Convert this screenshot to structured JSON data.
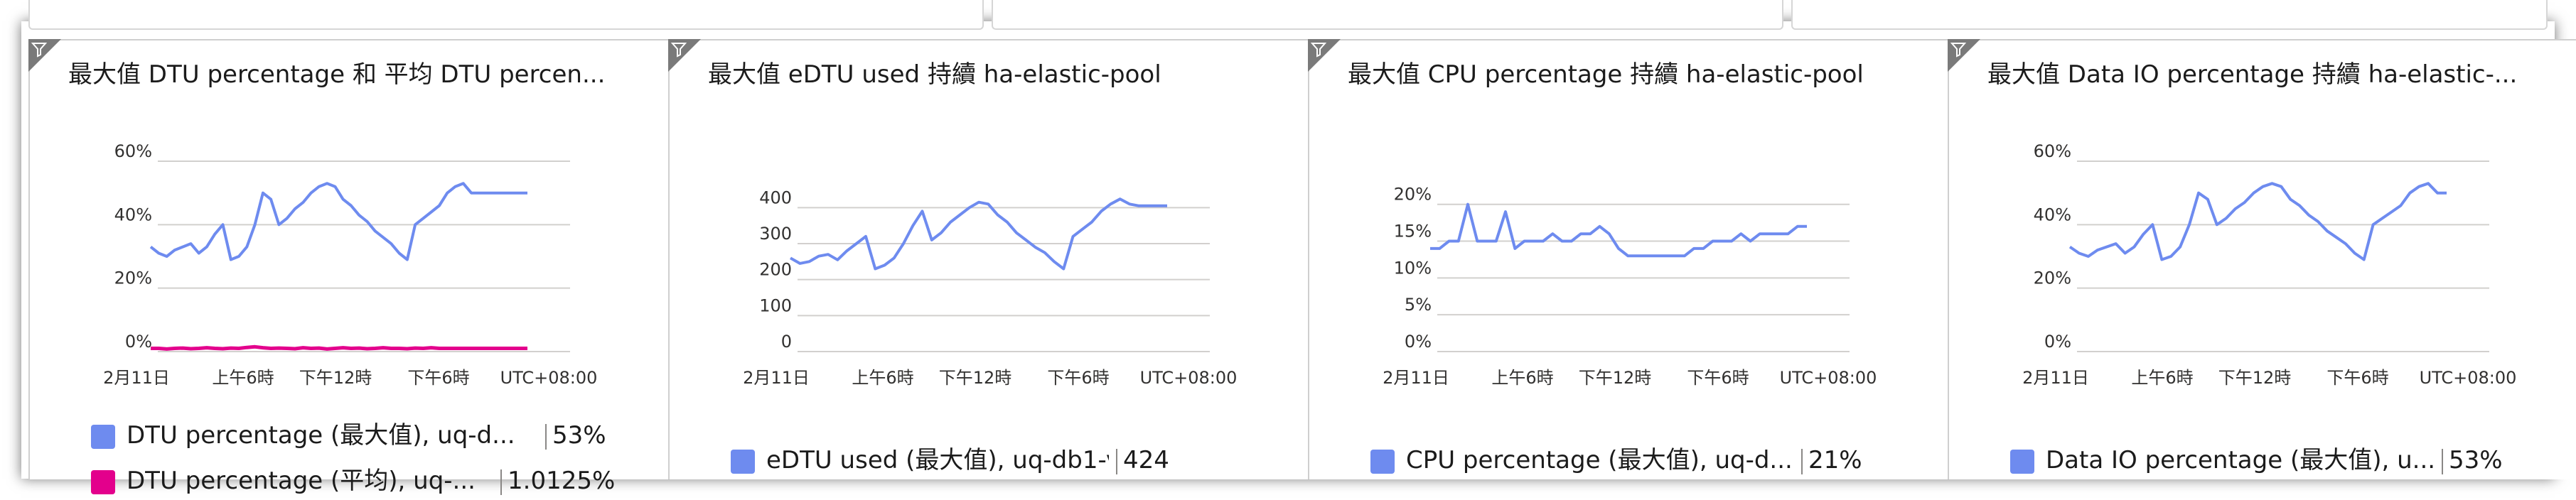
{
  "colors": {
    "blue_series": "#6E8BEF",
    "pink_series": "#E3008C",
    "grid": "#d2d0ce",
    "badge": "#7a7a7a"
  },
  "tiles": [
    {
      "title": "最大值 DTU percentage 和 平均 DTU percen...",
      "y_ticks": [
        "60%",
        "40%",
        "20%",
        "0%"
      ],
      "x_ticks": [
        "2月11日",
        "上午6時",
        "下午12時",
        "下午6時",
        "UTC+08:00"
      ],
      "legend": [
        {
          "label": "DTU percentage (最大值), uq-d...",
          "value": "53%",
          "icon": "blue-swatch"
        },
        {
          "label": "DTU percentage (平均), uq-...",
          "value": "1.0125%",
          "icon": "pink-swatch"
        }
      ]
    },
    {
      "title": "最大值 eDTU used 持續 ha-elastic-pool",
      "y_ticks": [
        "400",
        "300",
        "200",
        "100",
        "0"
      ],
      "x_ticks": [
        "2月11日",
        "上午6時",
        "下午12時",
        "下午6時",
        "UTC+08:00"
      ],
      "legend": [
        {
          "label": "eDTU used (最大值), uq-db1-v...",
          "value": "424",
          "icon": "blue-swatch"
        }
      ]
    },
    {
      "title": "最大值 CPU percentage 持續 ha-elastic-pool",
      "y_ticks": [
        "20%",
        "15%",
        "10%",
        "5%",
        "0%"
      ],
      "x_ticks": [
        "2月11日",
        "上午6時",
        "下午12時",
        "下午6時",
        "UTC+08:00"
      ],
      "legend": [
        {
          "label": "CPU percentage (最大值), uq-d...",
          "value": "21%",
          "icon": "blue-swatch"
        }
      ]
    },
    {
      "title": "最大值 Data IO percentage 持續 ha-elastic-...",
      "y_ticks": [
        "60%",
        "40%",
        "20%",
        "0%"
      ],
      "x_ticks": [
        "2月11日",
        "上午6時",
        "下午12時",
        "下午6時",
        "UTC+08:00"
      ],
      "legend": [
        {
          "label": "Data IO percentage (最大值), u...",
          "value": "53%",
          "icon": "blue-swatch"
        }
      ]
    }
  ],
  "chart_data": [
    {
      "type": "line",
      "ylim": [
        0,
        60
      ],
      "x": [
        0,
        1,
        2,
        3,
        4,
        5,
        6,
        7,
        8,
        9,
        10,
        11,
        12,
        13,
        14,
        15,
        16,
        17,
        18,
        19,
        20,
        21,
        22,
        23,
        24,
        25,
        26,
        27,
        28,
        29,
        30,
        31,
        32,
        33,
        34,
        35,
        36,
        37,
        38,
        39,
        40,
        41,
        42,
        43,
        44,
        45,
        46,
        47
      ],
      "series": [
        {
          "name": "DTU percentage (最大值), uq-d...",
          "color": "#6E8BEF",
          "values": [
            33,
            31,
            30,
            32,
            33,
            34,
            31,
            33,
            37,
            40,
            29,
            30,
            33,
            40,
            50,
            48,
            40,
            42,
            45,
            47,
            50,
            52,
            53,
            52,
            48,
            46,
            43,
            41,
            38,
            36,
            34,
            31,
            29,
            40,
            42,
            44,
            46,
            50,
            52,
            53,
            50,
            50,
            50,
            50,
            50,
            50,
            50,
            50
          ]
        },
        {
          "name": "DTU percentage (平均), uq-...",
          "color": "#E3008C",
          "values": [
            1,
            1,
            0.8,
            1,
            1.1,
            0.9,
            1,
            1.2,
            1,
            0.9,
            1.1,
            1,
            1.3,
            1.5,
            1.2,
            1,
            1.1,
            1,
            0.9,
            1.2,
            1,
            1.1,
            0.8,
            1,
            1.2,
            1,
            1.1,
            0.9,
            1,
            1.2,
            1,
            1,
            0.9,
            1.1,
            1,
            1.2,
            1,
            1,
            1,
            1,
            1,
            1,
            1,
            1,
            1,
            1,
            1,
            1
          ]
        }
      ]
    },
    {
      "type": "line",
      "ylim": [
        0,
        450
      ],
      "x": [
        0,
        1,
        2,
        3,
        4,
        5,
        6,
        7,
        8,
        9,
        10,
        11,
        12,
        13,
        14,
        15,
        16,
        17,
        18,
        19,
        20,
        21,
        22,
        23,
        24,
        25,
        26,
        27,
        28,
        29,
        30,
        31,
        32,
        33,
        34,
        35,
        36,
        37,
        38,
        39,
        40
      ],
      "series": [
        {
          "name": "eDTU used (最大值), uq-db1-v...",
          "color": "#6E8BEF",
          "values": [
            260,
            245,
            250,
            265,
            270,
            255,
            280,
            300,
            320,
            230,
            240,
            260,
            300,
            350,
            390,
            310,
            330,
            360,
            380,
            400,
            415,
            410,
            380,
            360,
            330,
            310,
            290,
            275,
            250,
            230,
            320,
            340,
            360,
            390,
            410,
            424,
            410,
            405,
            405,
            405,
            405
          ]
        }
      ]
    },
    {
      "type": "line",
      "ylim": [
        0,
        22
      ],
      "x": [
        0,
        1,
        2,
        3,
        4,
        5,
        6,
        7,
        8,
        9,
        10,
        11,
        12,
        13,
        14,
        15,
        16,
        17,
        18,
        19,
        20,
        21,
        22,
        23,
        24,
        25,
        26,
        27,
        28,
        29,
        30,
        31,
        32,
        33,
        34,
        35,
        36,
        37,
        38,
        39,
        40
      ],
      "series": [
        {
          "name": "CPU percentage (最大值), uq-d...",
          "color": "#6E8BEF",
          "values": [
            14,
            14,
            15,
            15,
            20,
            15,
            15,
            15,
            19,
            14,
            15,
            15,
            15,
            16,
            15,
            15,
            16,
            16,
            17,
            16,
            14,
            13,
            13,
            13,
            13,
            13,
            13,
            13,
            14,
            14,
            15,
            15,
            15,
            16,
            15,
            16,
            16,
            16,
            16,
            17,
            17
          ]
        }
      ]
    },
    {
      "type": "line",
      "ylim": [
        0,
        60
      ],
      "x": [
        0,
        1,
        2,
        3,
        4,
        5,
        6,
        7,
        8,
        9,
        10,
        11,
        12,
        13,
        14,
        15,
        16,
        17,
        18,
        19,
        20,
        21,
        22,
        23,
        24,
        25,
        26,
        27,
        28,
        29,
        30,
        31,
        32,
        33,
        34,
        35,
        36,
        37,
        38,
        39,
        40,
        41
      ],
      "series": [
        {
          "name": "Data IO percentage (最大值), u...",
          "color": "#6E8BEF",
          "values": [
            33,
            31,
            30,
            32,
            33,
            34,
            31,
            33,
            37,
            40,
            29,
            30,
            33,
            40,
            50,
            48,
            40,
            42,
            45,
            47,
            50,
            52,
            53,
            52,
            48,
            46,
            43,
            41,
            38,
            36,
            34,
            31,
            29,
            40,
            42,
            44,
            46,
            50,
            52,
            53,
            50,
            50
          ]
        }
      ]
    }
  ]
}
